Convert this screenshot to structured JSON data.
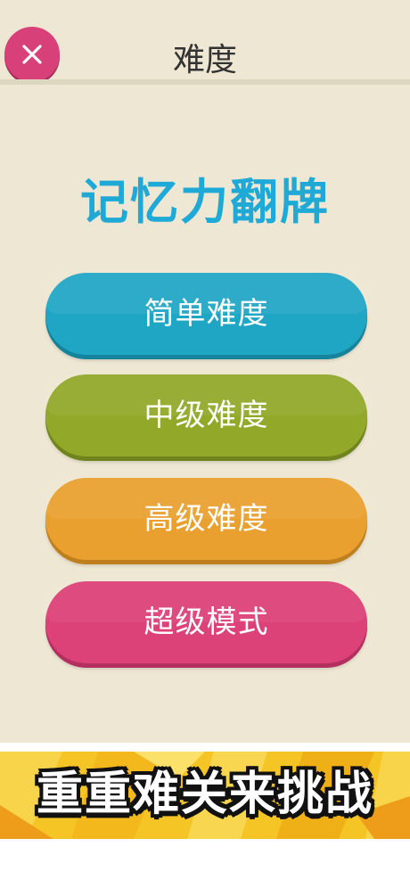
{
  "header": {
    "title": "难度",
    "close_icon": "close-icon"
  },
  "main": {
    "app_title": "记忆力翻牌",
    "buttons": [
      {
        "label": "简单难度",
        "color": "#20a6c5"
      },
      {
        "label": "中级难度",
        "color": "#91a829"
      },
      {
        "label": "高级难度",
        "color": "#e9a02f"
      },
      {
        "label": "超级模式",
        "color": "#dc4178"
      }
    ]
  },
  "banner": {
    "text": "重重难关来挑战"
  }
}
